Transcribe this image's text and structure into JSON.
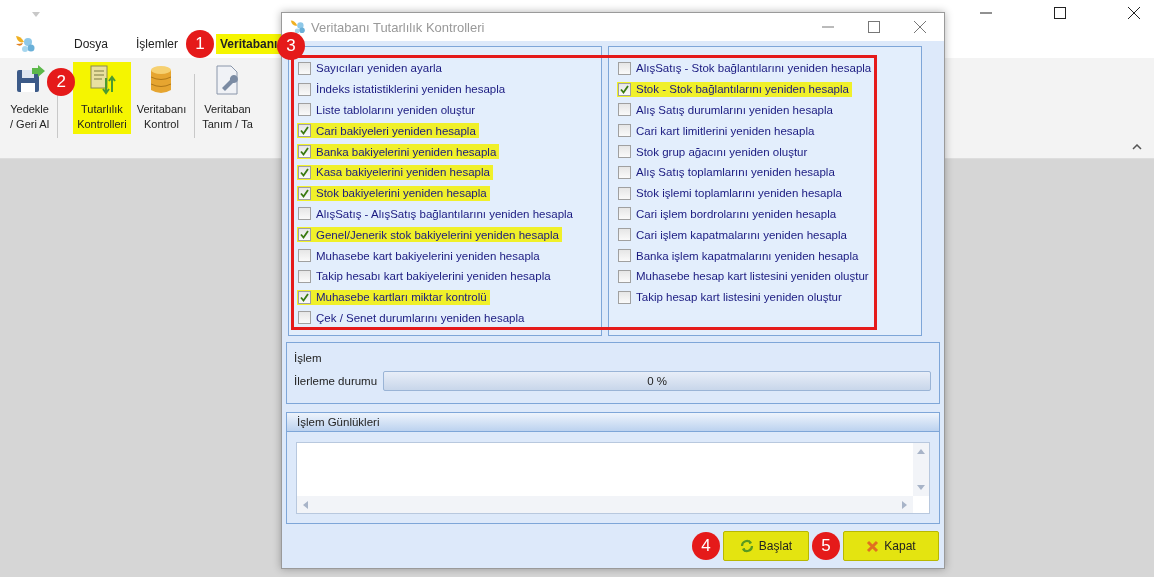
{
  "menu": [
    {
      "label": "Dosya",
      "highlighted": false
    },
    {
      "label": "İşlemler",
      "highlighted": false
    },
    {
      "label": "Veritabanı",
      "highlighted": true,
      "marker": "1"
    }
  ],
  "ribbon": [
    {
      "kind": "save",
      "lines": [
        "Yedekle",
        "/ Geri Al"
      ],
      "highlighted": false
    },
    {
      "kind": "checks",
      "lines": [
        "Tutarlılık",
        "Kontrolleri"
      ],
      "highlighted": true,
      "marker": "2"
    },
    {
      "kind": "database",
      "lines": [
        "Veritabanı",
        "Kontrol"
      ],
      "highlighted": false
    },
    {
      "kind": "tools",
      "lines": [
        "Veritaban",
        "Tanım / Ta"
      ],
      "highlighted": false
    }
  ],
  "dialog": {
    "title": "Veritabanı Tutarlılık Kontrolleri",
    "checks_marker": "3",
    "left_checks": [
      {
        "label": "Sayıcıları yeniden ayarla",
        "checked": false
      },
      {
        "label": "İndeks istatistiklerini yeniden hesapla",
        "checked": false
      },
      {
        "label": "Liste tablolarını yeniden oluştur",
        "checked": false
      },
      {
        "label": "Cari bakiyeleri yeniden hesapla",
        "checked": true
      },
      {
        "label": "Banka bakiyelerini yeniden hesapla",
        "checked": true
      },
      {
        "label": "Kasa bakiyelerini yeniden hesapla",
        "checked": true
      },
      {
        "label": "Stok bakiyelerini yeniden hesapla",
        "checked": true
      },
      {
        "label": "AlışSatış - AlışSatış bağlantılarını yeniden hesapla",
        "checked": false
      },
      {
        "label": "Genel/Jenerik stok bakiyelerini yeniden hesapla",
        "checked": true
      },
      {
        "label": "Muhasebe kart bakiyelerini yeniden hesapla",
        "checked": false
      },
      {
        "label": "Takip hesabı kart bakiyelerini yeniden hesapla",
        "checked": false
      },
      {
        "label": "Muhasebe kartları miktar kontrolü",
        "checked": true
      },
      {
        "label": "Çek / Senet durumlarını yeniden hesapla",
        "checked": false
      }
    ],
    "right_checks": [
      {
        "label": "AlışSatış - Stok bağlantılarını yeniden hesapla",
        "checked": false
      },
      {
        "label": "Stok - Stok bağlantılarını yeniden hesapla",
        "checked": true
      },
      {
        "label": "Alış Satış durumlarını yeniden hesapla",
        "checked": false
      },
      {
        "label": "Cari kart limitlerini yeniden hesapla",
        "checked": false
      },
      {
        "label": "Stok grup ağacını yeniden oluştur",
        "checked": false
      },
      {
        "label": "Alış Satış toplamlarını yeniden hesapla",
        "checked": false
      },
      {
        "label": "Stok işlemi toplamlarını yeniden hesapla",
        "checked": false
      },
      {
        "label": "Cari işlem bordrolarını yeniden hesapla",
        "checked": false
      },
      {
        "label": "Cari işlem kapatmalarını yeniden hesapla",
        "checked": false
      },
      {
        "label": "Banka işlem kapatmalarını yeniden hesapla",
        "checked": false
      },
      {
        "label": "Muhasebe hesap kart listesini yeniden oluştur",
        "checked": false
      },
      {
        "label": "Takip hesap kart listesini yeniden oluştur",
        "checked": false
      }
    ],
    "process": {
      "title": "İşlem",
      "progress_label": "İlerleme durumu",
      "level": 0,
      "reading": "0 %"
    },
    "logs": {
      "title": "İşlem Günlükleri"
    },
    "buttons": [
      {
        "kind": "start",
        "label": "Başlat",
        "highlighted": true,
        "marker": "4"
      },
      {
        "kind": "close",
        "label": "Kapat",
        "highlighted": true,
        "marker": "5"
      }
    ]
  }
}
